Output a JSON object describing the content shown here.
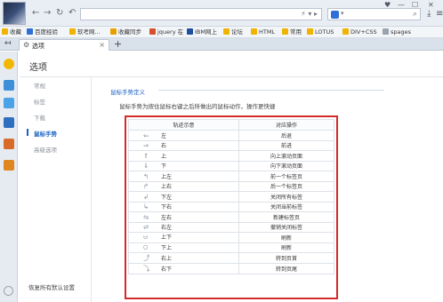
{
  "toolbar": {
    "address_right": "⚡ ▾ ▸",
    "search_dropdown": "▾",
    "window_controls": [
      "♥",
      "—",
      "☐",
      "✕"
    ]
  },
  "bookmarks": [
    {
      "label": "收藏",
      "color": "#f0b400"
    },
    {
      "label": "百度经验",
      "color": "#2f6fd6"
    },
    {
      "label": "软考网...",
      "color": "#f0b400"
    },
    {
      "label": "收藏同步",
      "color": "#e8a000"
    },
    {
      "label": "jquery 在",
      "color": "#d84f2a"
    },
    {
      "label": "IBM网上",
      "color": "#1f4f9f"
    },
    {
      "label": "论坛",
      "color": "#f0b400"
    },
    {
      "label": "HTML",
      "color": "#f0b400"
    },
    {
      "label": "常用",
      "color": "#f0b400"
    },
    {
      "label": "LOTUS",
      "color": "#f0b400"
    },
    {
      "label": "DIV+CSS",
      "color": "#f0b400"
    },
    {
      "label": "spages",
      "color": "#9aa3ad"
    }
  ],
  "tab": {
    "label": "选项"
  },
  "page": {
    "title": "选项",
    "nav": [
      "常规",
      "标签",
      "下载",
      "鼠标手势",
      "高级选项"
    ],
    "active_nav": "鼠标手势",
    "restore_label": "恢复所有默认设置"
  },
  "section": {
    "title": "鼠标手势定义",
    "description": "鼠标手势为按住鼠标右键之后所做出的鼠标动作，操作更快捷"
  },
  "gestures_table": {
    "headers": [
      "轨迹示意",
      "对应操作"
    ],
    "rows": [
      {
        "icon": "⇐",
        "gesture": "左",
        "action": "后退"
      },
      {
        "icon": "⇒",
        "gesture": "右",
        "action": "前进"
      },
      {
        "icon": "⇑",
        "gesture": "上",
        "action": "向上滚动页面"
      },
      {
        "icon": "⇓",
        "gesture": "下",
        "action": "向下滚动页面"
      },
      {
        "icon": "↰",
        "gesture": "上左",
        "action": "前一个标签页"
      },
      {
        "icon": "↱",
        "gesture": "上右",
        "action": "后一个标签页"
      },
      {
        "icon": "↲",
        "gesture": "下左",
        "action": "关闭所有标签"
      },
      {
        "icon": "↳",
        "gesture": "下右",
        "action": "关闭当前标签"
      },
      {
        "icon": "⇋",
        "gesture": "左右",
        "action": "新建标签页"
      },
      {
        "icon": "⇌",
        "gesture": "右左",
        "action": "撤销关闭标签"
      },
      {
        "icon": "⩁",
        "gesture": "上下",
        "action": "刷新"
      },
      {
        "icon": "⩂",
        "gesture": "下上",
        "action": "刷新"
      },
      {
        "icon": "⤴",
        "gesture": "右上",
        "action": "转到页首"
      },
      {
        "icon": "⤵",
        "gesture": "右下",
        "action": "转到页尾"
      }
    ]
  }
}
